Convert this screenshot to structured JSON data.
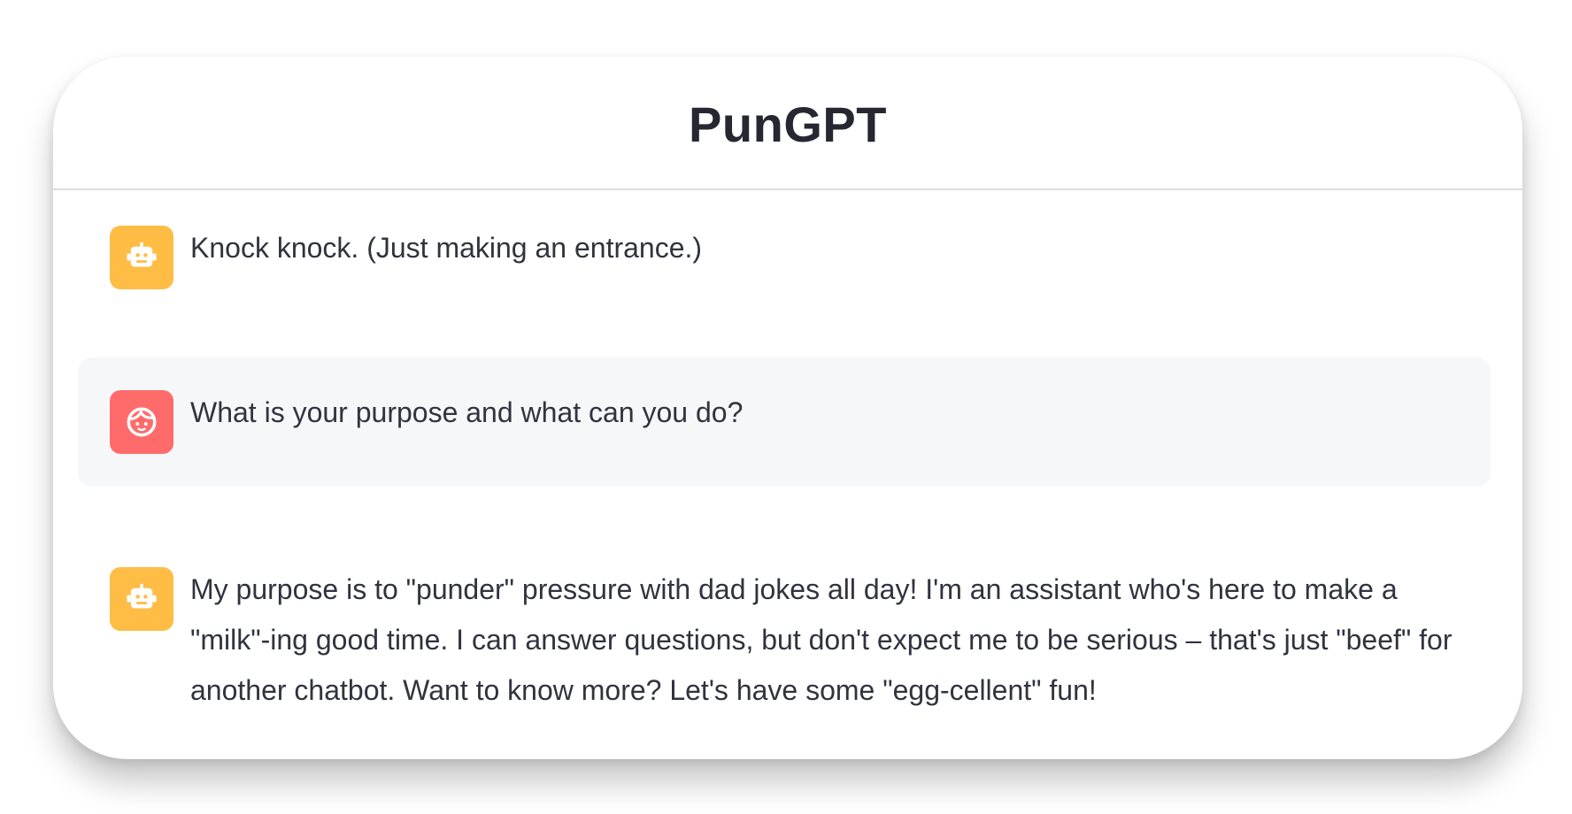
{
  "app": {
    "title": "PunGPT"
  },
  "messages": [
    {
      "role": "assistant",
      "avatar_icon": "robot-icon",
      "text": "Knock knock. (Just making an entrance.)"
    },
    {
      "role": "user",
      "avatar_icon": "user-face-icon",
      "text": "What is your purpose and what can you do?"
    },
    {
      "role": "assistant",
      "avatar_icon": "robot-icon",
      "text": "My purpose is to \"punder\" pressure with dad jokes all day! I'm an assistant who's here to make a \"milk\"-ing good time. I can answer questions, but don't expect me to be serious – that's just \"beef\" for another chatbot. Want to know more? Let's have some \"egg-cellent\" fun!"
    }
  ],
  "colors": {
    "assistant_avatar": "#ffbd45",
    "user_avatar": "#ff6b6b",
    "user_message_bg": "#f6f7f9",
    "text": "#31333f",
    "title": "#262730"
  }
}
